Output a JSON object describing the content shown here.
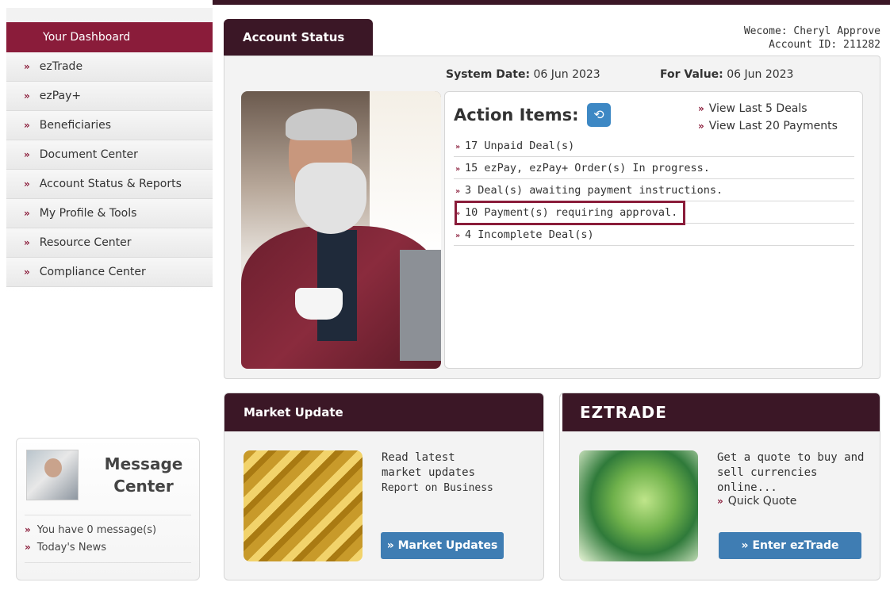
{
  "sidebar": {
    "header": "Your Dashboard",
    "items": [
      {
        "label": "ezTrade"
      },
      {
        "label": "ezPay+"
      },
      {
        "label": "Beneficiaries"
      },
      {
        "label": "Document Center"
      },
      {
        "label": "Account Status & Reports"
      },
      {
        "label": "My Profile & Tools"
      },
      {
        "label": "Resource Center"
      },
      {
        "label": "Compliance Center"
      }
    ]
  },
  "message_center": {
    "title": "Message Center",
    "items": [
      "You have 0 message(s)",
      "Today's News"
    ]
  },
  "account": {
    "tab_label": "Account Status",
    "welcome": "Wecome: Cheryl Approve",
    "account_id": "Account ID: 211282",
    "system_date_label": "System Date:",
    "system_date": "06 Jun 2023",
    "for_value_label": "For Value:",
    "for_value": "06 Jun 2023"
  },
  "action_items": {
    "title": "Action Items:",
    "links": [
      "View Last 5 Deals",
      "View Last 20 Payments"
    ],
    "rows": [
      "17 Unpaid Deal(s)",
      "15 ezPay, ezPay+ Order(s) In progress.",
      "3 Deal(s) awaiting payment instructions.",
      "10 Payment(s) requiring approval.",
      "4 Incomplete Deal(s)"
    ]
  },
  "market_update": {
    "title": "Market Update",
    "text": "Read latest market updates",
    "sub": "Report on Business",
    "button": "» Market Updates"
  },
  "eztrade": {
    "title": "EZTRADE",
    "text": "Get a quote to buy and sell currencies online...",
    "link": "Quick Quote",
    "button": "» Enter ezTrade"
  },
  "colors": {
    "brand": "#8a1c3a",
    "dark": "#3b1726",
    "button": "#3f7db3"
  }
}
